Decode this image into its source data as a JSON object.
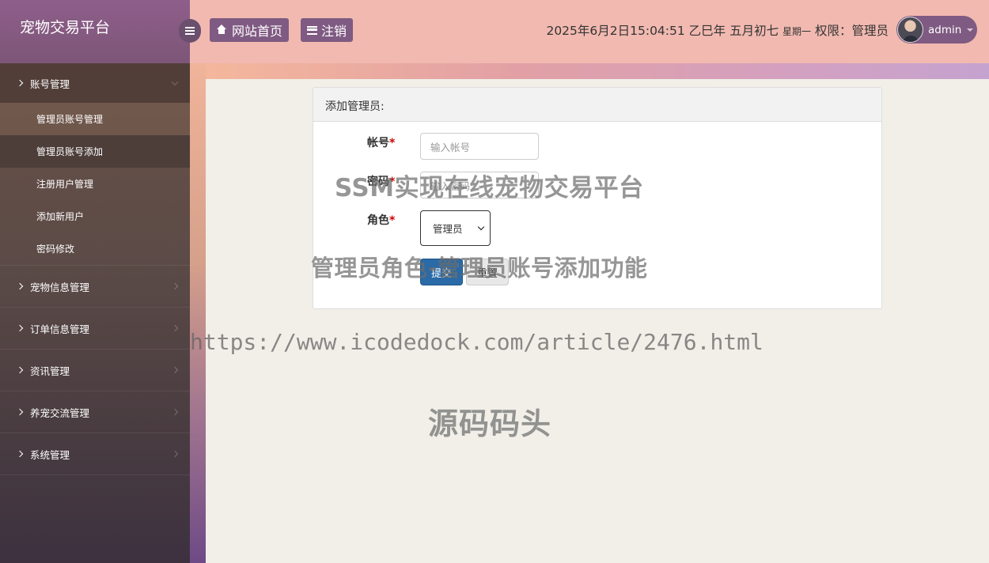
{
  "app": {
    "brand": "宠物交易平台"
  },
  "header": {
    "home_label": "网站首页",
    "logout_label": "注销",
    "datetime": "2025年6月2日15:04:51 乙巳年 五月初七",
    "weekday": "星期一",
    "role_text": "权限：管理员",
    "username": "admin"
  },
  "sidebar": {
    "groups": [
      {
        "label": "账号管理",
        "open": true,
        "items": [
          "管理员账号管理",
          "管理员账号添加",
          "注册用户管理",
          "添加新用户",
          "密码修改"
        ]
      },
      {
        "label": "宠物信息管理"
      },
      {
        "label": "订单信息管理"
      },
      {
        "label": "资讯管理"
      },
      {
        "label": "养宠交流管理"
      },
      {
        "label": "系统管理"
      }
    ]
  },
  "form": {
    "title": "添加管理员:",
    "account_label": "帐号",
    "account_placeholder": "输入帐号",
    "password_label": "密码",
    "password_placeholder": "输入密码",
    "role_label": "角色",
    "role_value": "管理员",
    "required_mark": "*",
    "submit_label": "提交",
    "reset_label": "重置"
  },
  "watermarks": {
    "line1": "SSM实现在线宠物交易平台",
    "line2": "管理员角色-管理员账号添加功能",
    "line3": "https://www.icodedock.com/article/2476.html",
    "line4": "源码码头"
  }
}
